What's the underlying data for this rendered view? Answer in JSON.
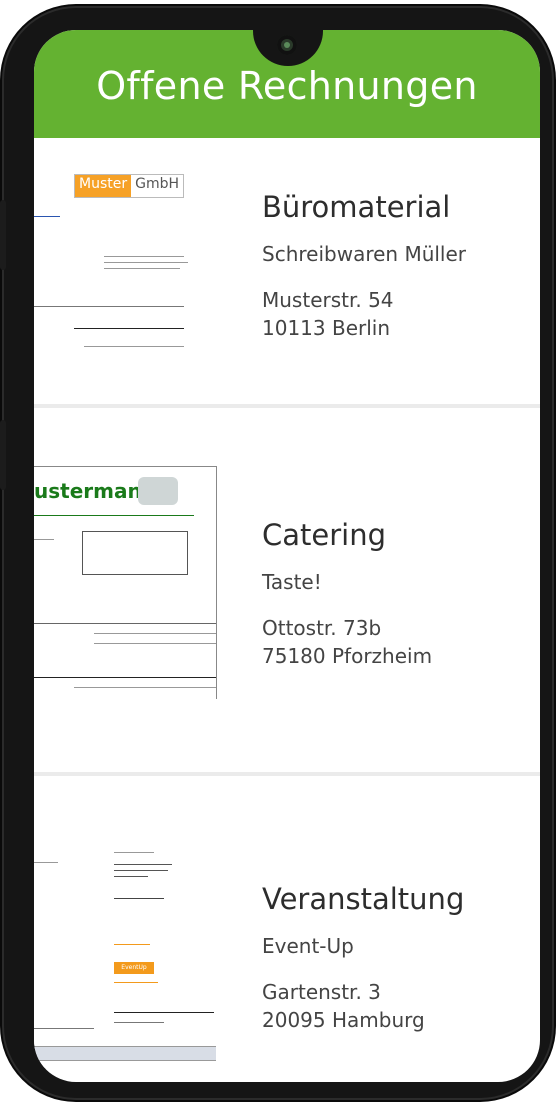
{
  "header": {
    "title": "Offene Rechnungen"
  },
  "invoices": [
    {
      "title": "Büromaterial",
      "company": "Schreibwaren Müller",
      "street": "Musterstr. 54",
      "city": "10113 Berlin",
      "thumb_logo_part1": "Muster",
      "thumb_logo_part2": "GmbH"
    },
    {
      "title": "Catering",
      "company": "Taste!",
      "street": "Ottostr. 73b",
      "city": "75180 Pforzheim",
      "thumb_logo": "ustermann"
    },
    {
      "title": "Veranstaltung",
      "company": "Event-Up",
      "street": "Gartenstr. 3",
      "city": "20095 Hamburg",
      "thumb_badge": "EventUp"
    }
  ],
  "colors": {
    "header_bg": "#64b231",
    "accent_orange": "#f39a1c"
  }
}
